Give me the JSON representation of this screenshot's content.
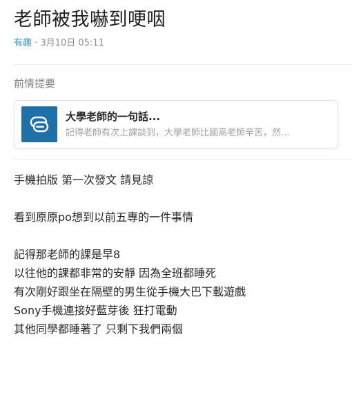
{
  "post": {
    "title": "老師被我嚇到哽咽",
    "forum": "有趣",
    "separator": "·",
    "datetime": "3月10日 05:11"
  },
  "previous": {
    "label": "前情提要",
    "card_title": "大學老師的一句話...",
    "card_excerpt": "記得老師有次上課談到，大學老師比國高老師辛苦，然..."
  },
  "content": {
    "lines": [
      "手機拍版 第一次發文 請見諒",
      "",
      "看到原原po想到以前五專的一件事情",
      "",
      "記得那老師的課是早8",
      "以往他的課都非常的安靜 因為全班都睡死",
      "有次剛好跟坐在隔壁的男生從手機大巴下載遊戲",
      "Sony手機連接好藍芽後 狂打電動",
      "其他同學都睡著了 只剩下我們兩個"
    ]
  },
  "colors": {
    "forum_link": "#3397cf",
    "link_icon_bg": "#1f6fa8"
  },
  "icons": {
    "link_card_icon": "link-icon"
  }
}
